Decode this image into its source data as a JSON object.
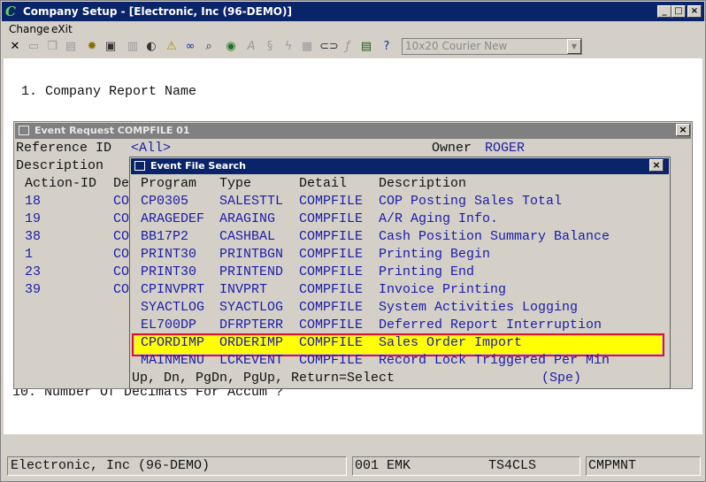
{
  "window": {
    "title": "Company Setup - [Electronic, Inc (96-DEMO)]",
    "minimize": "_",
    "maximize": "□",
    "close": "×"
  },
  "menu": {
    "change": "Change",
    "exit": "eXit"
  },
  "toolbar": {
    "font_select": "10x20 Courier New",
    "icons": [
      "close-icon",
      "new-icon",
      "copy-icon",
      "paste-icon",
      "settings-icon",
      "properties-icon",
      "list-icon",
      "speaker-icon",
      "bell-icon",
      "binoculars-icon",
      "find-icon",
      "globe-icon",
      "script-icon",
      "scroll-icon",
      "lightning-icon",
      "image-icon",
      "link-icon",
      "function-icon",
      "calculator-icon",
      "help-pointer-icon"
    ]
  },
  "background": {
    "line1": "1. Company Report Name",
    "line10": "10. Number Of Decimals For Accum ?"
  },
  "event_request": {
    "title": "Event Request COMPFILE 01",
    "reference_label": "Reference ID",
    "reference_value": "<All>",
    "owner_label": "Owner",
    "owner_value": "ROGER",
    "description_label": "Description",
    "action_id_header": "Action-ID",
    "de_header": "De",
    "rows": [
      {
        "id": "18",
        "c": "CO"
      },
      {
        "id": "19",
        "c": "CO"
      },
      {
        "id": "38",
        "c": "CO"
      },
      {
        "id": "1",
        "c": "CO"
      },
      {
        "id": "23",
        "c": "CO"
      },
      {
        "id": "39",
        "c": "CO"
      }
    ]
  },
  "event_file_search": {
    "title": "Event File Search",
    "headers": {
      "program": "Program",
      "type": "Type",
      "detail": "Detail",
      "description": "Description"
    },
    "rows": [
      {
        "program": "CP0305",
        "type": "SALESTTL",
        "detail": "COMPFILE",
        "description": "COP Posting Sales Total"
      },
      {
        "program": "ARAGEDEF",
        "type": "ARAGING",
        "detail": "COMPFILE",
        "description": "A/R Aging Info."
      },
      {
        "program": "BB17P2",
        "type": "CASHBAL",
        "detail": "COMPFILE",
        "description": "Cash Position Summary Balance"
      },
      {
        "program": "PRINT30",
        "type": "PRINTBGN",
        "detail": "COMPFILE",
        "description": "Printing Begin"
      },
      {
        "program": "PRINT30",
        "type": "PRINTEND",
        "detail": "COMPFILE",
        "description": "Printing End"
      },
      {
        "program": "CPINVPRT",
        "type": "INVPRT",
        "detail": "COMPFILE",
        "description": "Invoice Printing"
      },
      {
        "program": "SYACTLOG",
        "type": "SYACTLOG",
        "detail": "COMPFILE",
        "description": "System Activities Logging"
      },
      {
        "program": "EL700DP",
        "type": "DFRPTERR",
        "detail": "COMPFILE",
        "description": "Deferred Report Interruption"
      },
      {
        "program": "CPORDIMP",
        "type": "ORDERIMP",
        "detail": "COMPFILE",
        "description": "Sales Order Import"
      },
      {
        "program": "MAINMENU",
        "type": "LCKEVENT",
        "detail": "COMPFILE",
        "description": "Record Lock Triggered Per Min"
      }
    ],
    "footer": "Up, Dn, PgDn, PgUp, Return=Select",
    "footer_right": "(Spe)"
  },
  "status": {
    "company": "Electronic, Inc (96-DEMO)",
    "user": "001 EMK",
    "terminal": "TS4CLS",
    "program": "CMPMNT"
  },
  "colors": {
    "highlight": "#ffff00",
    "highlight_border": "#e0102a",
    "text_blue": "#1c1ca8",
    "title_active": "#0a246a"
  }
}
